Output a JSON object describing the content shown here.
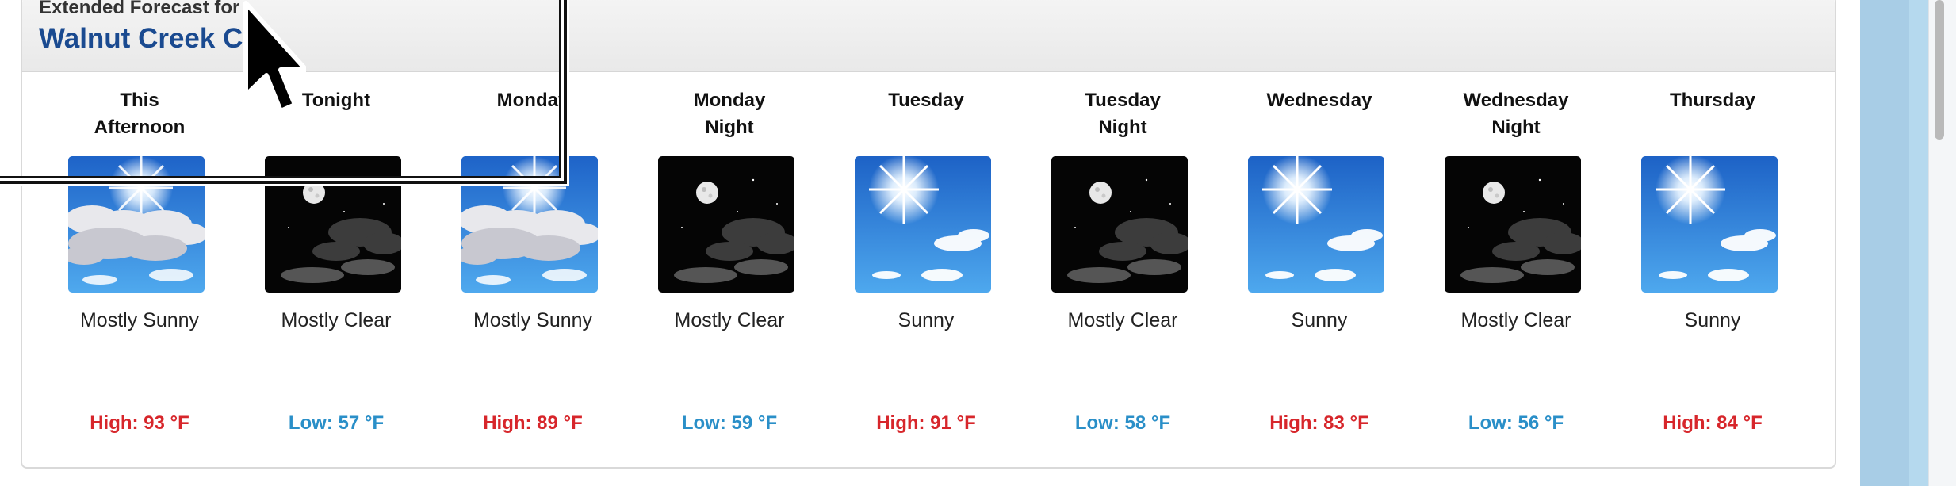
{
  "header": {
    "label": "Extended Forecast for",
    "location": "Walnut Creek CA"
  },
  "periods": [
    {
      "name": "This\nAfternoon",
      "icon": "sun-clouds-icon",
      "desc": "Mostly Sunny",
      "temp": "High: 93 °F",
      "kind": "high"
    },
    {
      "name": "Tonight",
      "icon": "moon-clouds-icon",
      "desc": "Mostly Clear",
      "temp": "Low: 57 °F",
      "kind": "low"
    },
    {
      "name": "Monday",
      "icon": "sun-clouds-icon",
      "desc": "Mostly Sunny",
      "temp": "High: 89 °F",
      "kind": "high"
    },
    {
      "name": "Monday\nNight",
      "icon": "moon-clouds-icon",
      "desc": "Mostly Clear",
      "temp": "Low: 59 °F",
      "kind": "low"
    },
    {
      "name": "Tuesday",
      "icon": "sun-icon",
      "desc": "Sunny",
      "temp": "High: 91 °F",
      "kind": "high"
    },
    {
      "name": "Tuesday\nNight",
      "icon": "moon-clouds-icon",
      "desc": "Mostly Clear",
      "temp": "Low: 58 °F",
      "kind": "low"
    },
    {
      "name": "Wednesday",
      "icon": "sun-icon",
      "desc": "Sunny",
      "temp": "High: 83 °F",
      "kind": "high"
    },
    {
      "name": "Wednesday\nNight",
      "icon": "moon-clouds-icon",
      "desc": "Mostly Clear",
      "temp": "Low: 56 °F",
      "kind": "low"
    },
    {
      "name": "Thursday",
      "icon": "sun-icon",
      "desc": "Sunny",
      "temp": "High: 84 °F",
      "kind": "high"
    }
  ],
  "colors": {
    "high": "#d7262b",
    "low": "#2a8fc8",
    "location": "#1a4a90"
  }
}
